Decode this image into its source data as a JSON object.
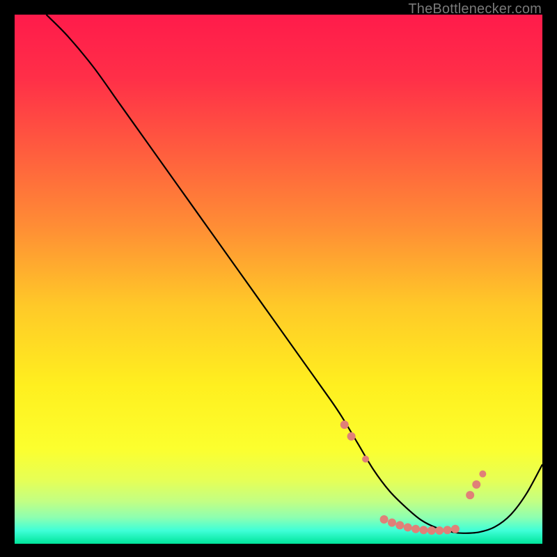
{
  "watermark": "TheBottlenecker.com",
  "chart_data": {
    "type": "line",
    "title": "",
    "xlabel": "",
    "ylabel": "",
    "xlim": [
      0,
      100
    ],
    "ylim": [
      0,
      100
    ],
    "gradient_stops": [
      {
        "pct": 0,
        "color": "#ff1b4b"
      },
      {
        "pct": 12,
        "color": "#ff2f48"
      },
      {
        "pct": 25,
        "color": "#ff5a3f"
      },
      {
        "pct": 40,
        "color": "#ff8d35"
      },
      {
        "pct": 55,
        "color": "#ffc928"
      },
      {
        "pct": 70,
        "color": "#ffef1f"
      },
      {
        "pct": 82,
        "color": "#fcff2e"
      },
      {
        "pct": 88,
        "color": "#e6ff56"
      },
      {
        "pct": 92,
        "color": "#c2ff84"
      },
      {
        "pct": 95,
        "color": "#8effb0"
      },
      {
        "pct": 97.5,
        "color": "#3fffd8"
      },
      {
        "pct": 100,
        "color": "#00e59a"
      }
    ],
    "series": [
      {
        "name": "bottleneck-curve",
        "color": "#000000",
        "x": [
          6,
          10,
          15,
          20,
          25,
          30,
          35,
          40,
          45,
          50,
          55,
          60,
          62,
          65,
          68,
          71,
          74,
          77,
          80,
          83,
          85,
          88,
          91,
          94,
          97,
          100
        ],
        "y": [
          100,
          96,
          90,
          83,
          76,
          69,
          62,
          55,
          48,
          41,
          34,
          27,
          24,
          19,
          14,
          10,
          7,
          4.5,
          3,
          2.2,
          2.0,
          2.2,
          3.2,
          5.5,
          9.5,
          15
        ]
      }
    ],
    "markers": {
      "name": "markers",
      "color": "#e08078",
      "points": [
        {
          "x": 62.5,
          "y": 22.5,
          "r": 6
        },
        {
          "x": 63.8,
          "y": 20.3,
          "r": 6
        },
        {
          "x": 66.5,
          "y": 16.0,
          "r": 5
        },
        {
          "x": 70.0,
          "y": 4.6,
          "r": 6
        },
        {
          "x": 71.5,
          "y": 4.0,
          "r": 6
        },
        {
          "x": 73.0,
          "y": 3.5,
          "r": 6
        },
        {
          "x": 74.5,
          "y": 3.1,
          "r": 6
        },
        {
          "x": 76.0,
          "y": 2.8,
          "r": 6
        },
        {
          "x": 77.5,
          "y": 2.6,
          "r": 6
        },
        {
          "x": 79.0,
          "y": 2.5,
          "r": 6
        },
        {
          "x": 80.5,
          "y": 2.5,
          "r": 6
        },
        {
          "x": 82.0,
          "y": 2.6,
          "r": 6
        },
        {
          "x": 83.5,
          "y": 2.8,
          "r": 6
        },
        {
          "x": 86.3,
          "y": 9.2,
          "r": 6
        },
        {
          "x": 87.5,
          "y": 11.2,
          "r": 6
        },
        {
          "x": 88.7,
          "y": 13.2,
          "r": 5
        }
      ]
    }
  }
}
